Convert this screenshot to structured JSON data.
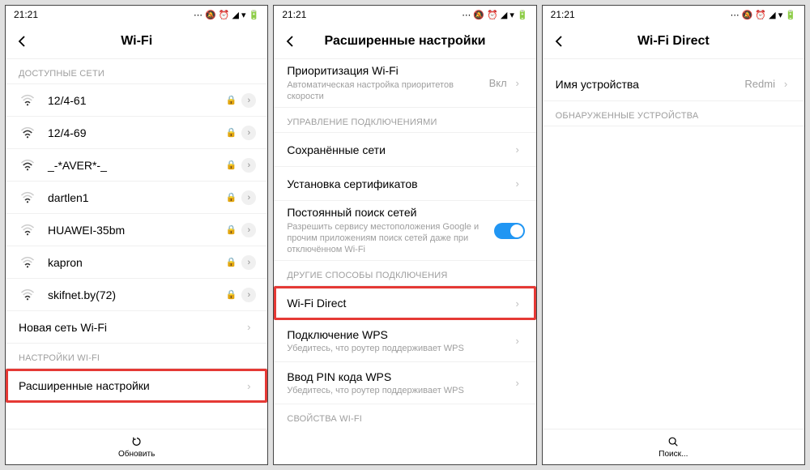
{
  "status": {
    "time": "21:21",
    "icons_text": "⋯ 🔕 ⏰ ◢ ▾ 🔋"
  },
  "screen1": {
    "title": "Wi-Fi",
    "section_available": "ДОСТУПНЫЕ СЕТИ",
    "networks": [
      {
        "ssid": "12/4-61",
        "locked": true,
        "strength": 1
      },
      {
        "ssid": "12/4-69",
        "locked": true,
        "strength": 2
      },
      {
        "ssid": "_-*AVER*-_",
        "locked": true,
        "strength": 2
      },
      {
        "ssid": "dartlen1",
        "locked": true,
        "strength": 1
      },
      {
        "ssid": "HUAWEI-35bm",
        "locked": true,
        "strength": 1
      },
      {
        "ssid": "kapron",
        "locked": true,
        "strength": 1
      },
      {
        "ssid": "skifnet.by(72)",
        "locked": true,
        "strength": 1
      }
    ],
    "new_network": "Новая сеть Wi-Fi",
    "section_settings": "НАСТРОЙКИ WI-FI",
    "advanced": "Расширенные настройки",
    "refresh": "Обновить"
  },
  "screen2": {
    "title": "Расширенные настройки",
    "priority": {
      "ttl": "Приоритизация Wi-Fi",
      "sub": "Автоматическая настройка приоритетов скорости",
      "val": "Вкл"
    },
    "section_conn": "УПРАВЛЕНИЕ ПОДКЛЮЧЕНИЯМИ",
    "saved": "Сохранённые сети",
    "certs": "Установка сертификатов",
    "scan": {
      "ttl": "Постоянный поиск сетей",
      "sub": "Разрешить сервису местоположения Google и прочим приложениям поиск сетей даже при отключённом Wi-Fi"
    },
    "section_other": "ДРУГИЕ СПОСОБЫ ПОДКЛЮЧЕНИЯ",
    "wfd": "Wi-Fi Direct",
    "wps": {
      "ttl": "Подключение WPS",
      "sub": "Убедитесь, что роутер поддерживает WPS"
    },
    "wps_pin": {
      "ttl": "Ввод PIN кода WPS",
      "sub": "Убедитесь, что роутер поддерживает WPS"
    },
    "section_props": "СВОЙСТВА WI-FI"
  },
  "screen3": {
    "title": "Wi-Fi Direct",
    "device_label": "Имя устройства",
    "device_value": "Redmi",
    "section_found": "ОБНАРУЖЕННЫЕ УСТРОЙСТВА",
    "search": "Поиск..."
  }
}
